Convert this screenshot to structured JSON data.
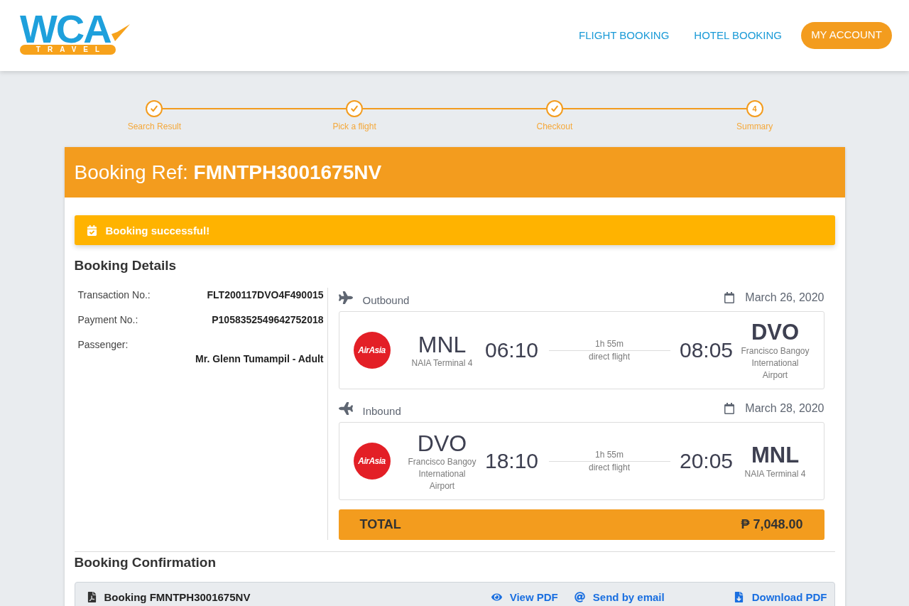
{
  "header": {
    "logo": {
      "wordmark": "WCA",
      "tagline": "TRAVEL"
    },
    "nav_links": [
      "FLIGHT BOOKING",
      "HOTEL BOOKING"
    ],
    "account_button": "MY ACCOUNT"
  },
  "steps": [
    {
      "label": "Search Result",
      "completed": true
    },
    {
      "label": "Pick a flight",
      "completed": true
    },
    {
      "label": "Checkout",
      "completed": true
    },
    {
      "label": "Summary",
      "completed": false,
      "number": "4"
    }
  ],
  "booking": {
    "title": "Booking Ref: **FMNTPH3001675NV**",
    "alert": "Booking successful!",
    "details_heading": "Booking Details",
    "details": [
      {
        "kind": "inline",
        "label": "Transaction No.:",
        "value": "FLT200117DVO4F490015"
      },
      {
        "kind": "inline",
        "label": "Payment No.:",
        "value": "P1058352549642752018"
      },
      {
        "kind": "stacked",
        "label": "Passenger:",
        "value": "Mr. Glenn Tumampil - Adult"
      }
    ],
    "flights": [
      {
        "kind": "outbound",
        "direction": "Outbound",
        "date": "March 26, 2020",
        "airline": "AirAsia",
        "departure": {
          "code": "MNL",
          "airport": "NAIA Terminal 4",
          "time": "06:10"
        },
        "duration": "1h 55m",
        "stops": "direct flight",
        "arrival": {
          "code": "DVO",
          "airport": "Francisco Bangoy International Airport",
          "time": "08:05"
        }
      },
      {
        "kind": "inbound",
        "direction": "Inbound",
        "date": "March 28, 2020",
        "airline": "AirAsia",
        "departure": {
          "code": "DVO",
          "airport": "Francisco Bangoy International Airport",
          "time": "18:10"
        },
        "duration": "1h 55m",
        "stops": "direct flight",
        "arrival": {
          "code": "MNL",
          "airport": "NAIA Terminal 4",
          "time": "20:05"
        }
      }
    ],
    "total": {
      "label": "TOTAL",
      "amount": "₱ 7,048.00"
    },
    "confirmation": {
      "heading": "Booking Confirmation",
      "document": "Booking FMNTPH3001675NV",
      "actions": [
        {
          "kind": "view",
          "label": "View PDF"
        },
        {
          "kind": "email",
          "label": "Send by email"
        },
        {
          "kind": "download",
          "label": "Download PDF"
        }
      ]
    }
  }
}
